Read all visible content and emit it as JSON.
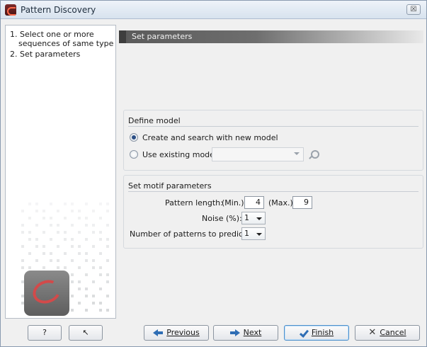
{
  "window": {
    "title": "Pattern Discovery",
    "close_glyph": "☒"
  },
  "sidebar": {
    "steps": [
      {
        "label": "1. Select one or more"
      },
      {
        "label": "sequences of same type"
      },
      {
        "label": "2. Set parameters"
      }
    ]
  },
  "content": {
    "header": "Set parameters",
    "define_model": {
      "title": "Define model",
      "option_new": "Create and search with new model",
      "option_existing": "Use existing model",
      "existing_value": ""
    },
    "motif_params": {
      "title": "Set motif parameters",
      "pattern_length_label": "Pattern length:",
      "min_label": "(Min.)",
      "min_value": "4",
      "max_label": "(Max.)",
      "max_value": "9",
      "noise_label": "Noise (%):",
      "noise_value": "1",
      "num_patterns_label": "Number of patterns to predict:",
      "num_patterns_value": "1"
    }
  },
  "footer": {
    "help_label": "?",
    "reset_glyph": "↖",
    "previous_label": "Previous",
    "next_label": "Next",
    "finish_label": "Finish",
    "cancel_label": "Cancel",
    "cancel_glyph": "✕"
  }
}
